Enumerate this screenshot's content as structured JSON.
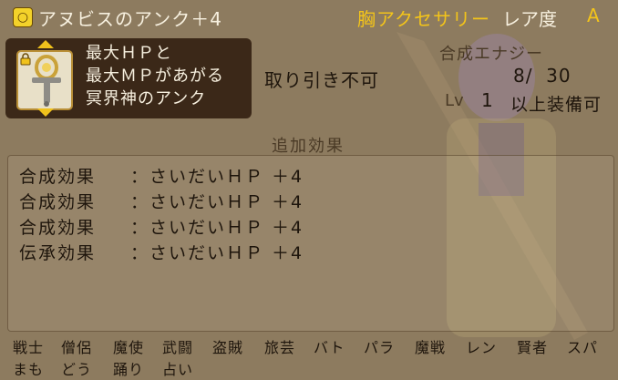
{
  "header": {
    "item_type_icon": "accessory-type-icon",
    "item_name": "アヌビスのアンク＋4",
    "category": "胸アクセサリー",
    "rarity_label": "レア度",
    "rarity_value": "A"
  },
  "item_icon": "ankh-icon",
  "description": {
    "lines": [
      "最大ＨＰと",
      "最大ＭＰがあがる",
      "冥界神のアンク"
    ]
  },
  "trade_status": "取り引き不可",
  "synthesis": {
    "label": "合成エナジー",
    "value": "8/  30"
  },
  "level": {
    "label": "Lv",
    "value": "1",
    "suffix": "以上装備可"
  },
  "added_effects": {
    "title": "追加効果",
    "rows": [
      {
        "type": "合成効果",
        "value": "：さいだいＨＰ ＋4"
      },
      {
        "type": "合成効果",
        "value": "：さいだいＨＰ ＋4"
      },
      {
        "type": "合成効果",
        "value": "：さいだいＨＰ ＋4"
      },
      {
        "type": "伝承効果",
        "value": "：さいだいＨＰ ＋4"
      }
    ]
  },
  "jobs": {
    "row1": [
      "戦士",
      "僧侶",
      "魔使",
      "武闘",
      "盗賊",
      "旅芸",
      "バト",
      "パラ",
      "魔戦",
      "レン",
      "賢者",
      "スパ"
    ],
    "row2": [
      "まも",
      "どう",
      "踊り",
      "占い"
    ]
  },
  "colors": {
    "background": "#8d7b5f",
    "accent_gold": "#f3c41a",
    "light_text": "#f7f0df"
  }
}
